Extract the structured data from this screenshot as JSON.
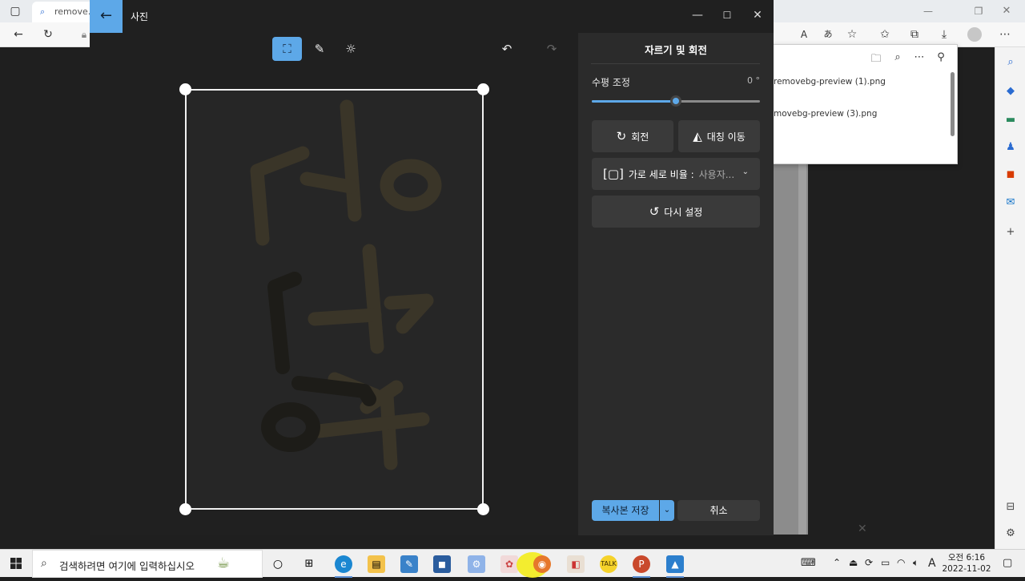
{
  "browser": {
    "tab_title": "remove.b",
    "downloads": {
      "files": [
        "removebg-preview (1).png",
        "movebg-preview (3).png"
      ]
    }
  },
  "photos": {
    "app_title": "사진",
    "panel": {
      "title": "자르기 및 회전",
      "level_label": "수평 조정",
      "level_value": "0 °",
      "level_fraction": 0.5,
      "rotate_label": "회전",
      "flip_label": "대칭 이동",
      "ratio_label": "가로 세로 비율 :",
      "ratio_value": "사용자...",
      "reset_label": "다시 설정",
      "save_label": "복사본 저장",
      "cancel_label": "취소"
    }
  },
  "taskbar": {
    "search_placeholder": "검색하려면 여기에 입력하십시오",
    "clock_time": "오전 6:16",
    "clock_date": "2022-11-02",
    "ime_label": "A"
  },
  "colors": {
    "accent": "#5da8e8",
    "panel_bg": "#2b2b2b",
    "app_bg": "#202020"
  }
}
